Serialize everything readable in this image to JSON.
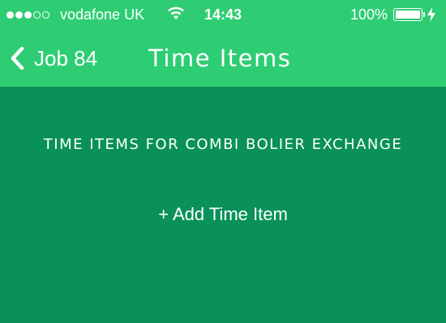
{
  "status_bar": {
    "signal_strength": "3 of 5",
    "carrier": "vodafone UK",
    "time": "14:43",
    "battery_percent": "100%",
    "battery_level": 1.0,
    "icons": [
      "signal-dots",
      "wifi-icon",
      "battery-icon",
      "charging-icon"
    ]
  },
  "nav_bar": {
    "back_label": "Job 84",
    "back_icon": "chevron-left-icon",
    "title": "Time Items"
  },
  "content": {
    "section_heading": "TIME ITEMS FOR COMBI BOLIER EXCHANGE",
    "add_button_label": "+ Add Time Item"
  },
  "colors": {
    "header_green": "#2ecd73",
    "content_green": "#099159",
    "text": "#ffffff"
  }
}
